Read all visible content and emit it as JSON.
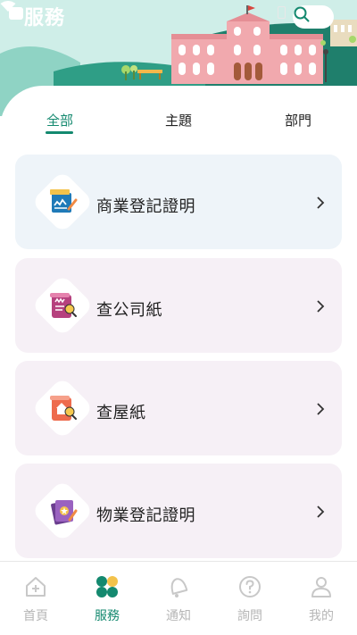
{
  "header": {
    "title": "服務",
    "search_icon": "search-icon"
  },
  "tabs": [
    {
      "label": "全部",
      "active": true
    },
    {
      "label": "主題",
      "active": false
    },
    {
      "label": "部門",
      "active": false
    }
  ],
  "services": [
    {
      "label": "商業登記證明",
      "icon": "business-registration-icon",
      "bg": "#eef4f9"
    },
    {
      "label": "查公司紙",
      "icon": "company-document-search-icon",
      "bg": "#f6f0f6"
    },
    {
      "label": "查屋紙",
      "icon": "property-document-search-icon",
      "bg": "#f6f0f6"
    },
    {
      "label": "物業登記證明",
      "icon": "property-registration-icon",
      "bg": "#f6f0f6"
    }
  ],
  "nav": [
    {
      "label": "首頁",
      "icon": "home-icon",
      "active": false
    },
    {
      "label": "服務",
      "icon": "services-icon",
      "active": true
    },
    {
      "label": "通知",
      "icon": "bell-icon",
      "active": false
    },
    {
      "label": "詢問",
      "icon": "question-icon",
      "active": false
    },
    {
      "label": "我的",
      "icon": "user-icon",
      "active": false
    }
  ],
  "colors": {
    "accent": "#14896f",
    "nav_inactive": "#b6b6b6"
  }
}
